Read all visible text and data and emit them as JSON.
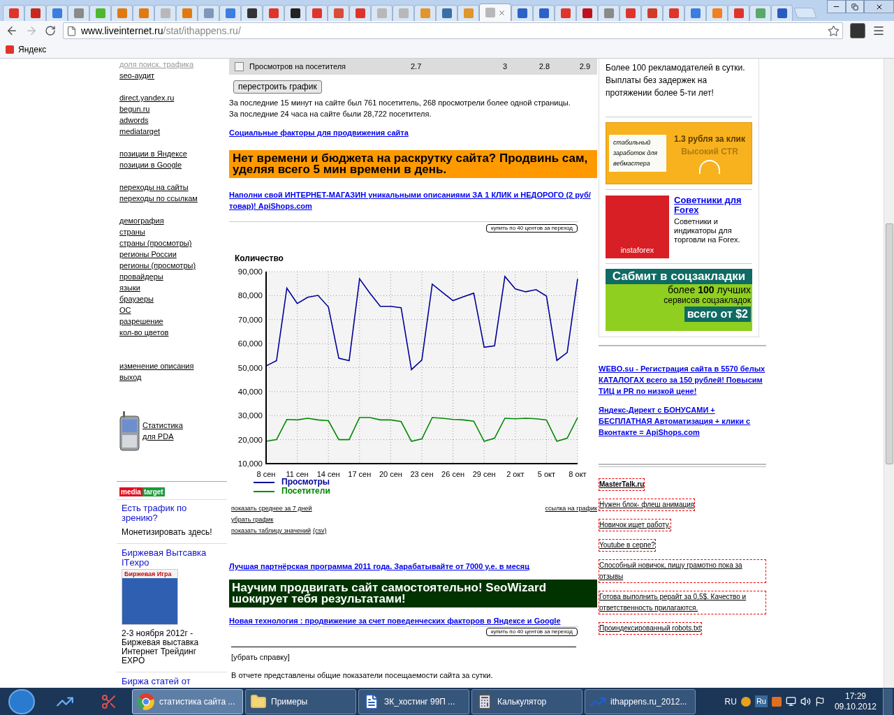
{
  "browser": {
    "tabs": [
      {
        "color": "#e0342a",
        "selected": false
      },
      {
        "color": "#c8281e",
        "selected": false
      },
      {
        "color": "#3b7de0",
        "selected": false
      },
      {
        "color": "#8a8a8a",
        "selected": false
      },
      {
        "color": "#4fb82e",
        "selected": false
      },
      {
        "color": "#e07a10",
        "selected": false
      },
      {
        "color": "#e07a10",
        "selected": false
      },
      {
        "color": "#b8b8b8",
        "selected": false
      },
      {
        "color": "#e07a10",
        "selected": false
      },
      {
        "color": "#7d98b8",
        "selected": false
      },
      {
        "color": "#3b7de0",
        "selected": false
      },
      {
        "color": "#333333",
        "selected": false
      },
      {
        "color": "#e0342a",
        "selected": false
      },
      {
        "color": "#222222",
        "selected": false
      },
      {
        "color": "#e0342a",
        "selected": false
      },
      {
        "color": "#d94c3a",
        "selected": false
      },
      {
        "color": "#e0342a",
        "selected": false
      },
      {
        "color": "#b8b8b8",
        "selected": false
      },
      {
        "color": "#b8b8b8",
        "selected": false
      },
      {
        "color": "#e0962a",
        "selected": false
      },
      {
        "color": "#3a6ea8",
        "selected": false
      },
      {
        "color": "#e0962a",
        "selected": false
      },
      {
        "color": "#b8b8b8",
        "selected": true
      },
      {
        "color": "#2c62c8",
        "selected": false
      },
      {
        "color": "#2c62c8",
        "selected": false
      },
      {
        "color": "#e0342a",
        "selected": false
      },
      {
        "color": "#c01020",
        "selected": false
      },
      {
        "color": "#8a8a8a",
        "selected": false
      },
      {
        "color": "#e0342a",
        "selected": false
      },
      {
        "color": "#d03a2a",
        "selected": false
      },
      {
        "color": "#e0342a",
        "selected": false
      },
      {
        "color": "#3b7de0",
        "selected": false
      },
      {
        "color": "#f08020",
        "selected": false
      },
      {
        "color": "#e0342a",
        "selected": false
      },
      {
        "color": "#5aa86a",
        "selected": false
      },
      {
        "color": "#2a5cc0",
        "selected": false
      }
    ],
    "url_host": "www.liveinternet.ru",
    "url_path": "/stat/ithappens.ru/",
    "bookmark": "Яндекс"
  },
  "sidebar": {
    "cut_link": "доля поиск. трафика",
    "groups": [
      [
        "seo-аудит"
      ],
      [
        "direct.yandex.ru",
        "begun.ru",
        "adwords",
        "mediatarget"
      ],
      [
        "позиции в Яндексе",
        "позиции в Google"
      ],
      [
        "переходы на сайты",
        "переходы по ссылкам"
      ],
      [
        "демография",
        "страны",
        "страны (просмотры)",
        "регионы России",
        "регионы (просмотры)",
        "провайдеры",
        "языки",
        "браузеры",
        "ОС",
        "разрешение",
        "кол-во цветов"
      ],
      [
        "изменение описания",
        "выход"
      ]
    ],
    "pda_link": "Статистика для PDA",
    "logo_left": "media",
    "logo_right": "target",
    "ad1_title": "Есть трафик по зрению?",
    "ad1_text": "Монетизировать здесь!",
    "ad2_title": "Биржевая Вытсавка ITехро",
    "ad2_image_title": "Биржевая Игра",
    "ad2_text": "2-3 ноября 2012г - Биржевая выставка Интернет Трейдинг EXPO",
    "ad3_title": "Биржа статей от"
  },
  "center": {
    "stats_row": {
      "checked": false,
      "label": "Просмотров на посетителя",
      "values": [
        "2.7",
        "3",
        "2.8",
        "2.9"
      ]
    },
    "rebuild_button": "перестроить график",
    "summary_lines": [
      "За последние 15 минут на сайте был 761 посетитель, 268 просмотрели более одной страницы.",
      "За последние 24 часа на сайте были 28,722 посетителя."
    ],
    "social_link": "Социальные факторы для продвижения сайта",
    "promo_orange": "Нет времени и бюджета на раскрутку сайта? Продвинь сам, уделяя всего 5 мин времени в день.",
    "shop_link": "Наполни свой ИНТЕРНЕТ-МАГАЗИН уникальными описаниями ЗА 1 КЛИК и НЕДОРОГО (2 руб/товар)! ApiShops.com",
    "buy_button_1": "купить по 40 центов за переход",
    "chart_data": {
      "type": "line",
      "ylabel": "Количество",
      "grid": true,
      "legend": "bottom",
      "categories": [
        "8 сен",
        null,
        null,
        "11 сен",
        null,
        null,
        "14 сен",
        null,
        null,
        "17 сен",
        null,
        null,
        "20 сен",
        null,
        null,
        "23 сен",
        null,
        null,
        "26 сен",
        null,
        null,
        "29 сен",
        null,
        null,
        "2 окт",
        null,
        null,
        "5 окт",
        null,
        null,
        "8 окт"
      ],
      "ylim": [
        10000,
        90000
      ],
      "yticks": [
        {
          "value": 10000,
          "label": "10,000"
        },
        {
          "value": 20000,
          "label": "20,000"
        },
        {
          "value": 30000,
          "label": "30,000"
        },
        {
          "value": 40000,
          "label": "40,000"
        },
        {
          "value": 50000,
          "label": "50,000"
        },
        {
          "value": 60000,
          "label": "60,000"
        },
        {
          "value": 70000,
          "label": "70,000"
        },
        {
          "value": 80000,
          "label": "80,000"
        },
        {
          "value": 90000,
          "label": "90,000"
        }
      ],
      "series": [
        {
          "name": "Просмотры",
          "color": "#000099",
          "values": [
            50700,
            52900,
            83100,
            76700,
            79300,
            80100,
            75300,
            53900,
            52900,
            87000,
            81000,
            75500,
            75500,
            75000,
            49200,
            53200,
            84800,
            81300,
            77900,
            79500,
            81000,
            58500,
            59100,
            88000,
            82800,
            81600,
            82500,
            79800,
            53000,
            56300,
            87000
          ]
        },
        {
          "name": "Посетители",
          "color": "#008800",
          "values": [
            19300,
            20000,
            28400,
            28200,
            28900,
            28200,
            27900,
            20000,
            20000,
            29200,
            29200,
            28200,
            28200,
            27500,
            19300,
            20300,
            29200,
            28900,
            28400,
            28200,
            27700,
            19300,
            20600,
            28900,
            28700,
            28900,
            28700,
            28200,
            19300,
            20600,
            29200
          ]
        }
      ]
    },
    "chart_links": {
      "average": "показать среднее за 7 дней",
      "link": "ссылка на график",
      "remove": "убрать график",
      "table": "показать таблицу значений",
      "csv": "(csv)"
    },
    "partner_link": "Лучшая партнёрская программа 2011 года. Зарабатывайте от 7000 у.е. в месяц",
    "promo_green": "Научим продвигать сайт самостоятельно! SeoWizard шокирует тебя результатами!",
    "tech_link": "Новая технология : продвижение за счет поведенческих факторов в Яндексе и Google",
    "buy_button_2": "купить по 40 центов за переход",
    "hide_help": "[убрать справку]",
    "report_text": "В отчете представлены общие показатели посещаемости сайта за сутки."
  },
  "right": {
    "intro": "Более 100 рекламодателей в сутки. Выплаты без задержек на протяжении более 5-ти лет!",
    "banner1": {
      "left": "стабильный заработок для вебмастера",
      "title": "1.3 рубля за клик",
      "subtitle": "Высокий CTR"
    },
    "forex": {
      "image_text": "instaforex",
      "title": "Советники для Forex",
      "text": "Советники и индикаторы для торговли на Forex."
    },
    "banner3": {
      "title": "Сабмит в соцзакладки",
      "line1": "более **100** лучших",
      "line2": "сервисов соцзакладок",
      "price": "всего от $2"
    },
    "links": [
      "WEBO.su - Регистрация сайта в 5570 белых КАТАЛОГАХ всего за 150 рублей! Повысим ТИЦ и PR по низкой цене!",
      "Яндекс-Директ с БОНУСАМИ + БЕСПЛАТНАЯ Автоматизация + клики с Вконтакте = ApiShops.com"
    ],
    "forum_links": [
      "MasterTalk.ru",
      "Нужен блок- флеш анимация",
      "Новичок ищет работу.",
      "Youtube в серпе?",
      "Способный новичок, пишу грамотно пока за отзывы",
      "Готова выполнить рерайт за 0,5$. Качество и ответственность прилагаются.",
      "Проиндексированный robots.txt"
    ]
  },
  "taskbar": {
    "items": [
      {
        "kind": "browser",
        "label": "статистика сайта ...",
        "selected": true
      },
      {
        "kind": "folder",
        "label": "Примеры",
        "selected": false
      },
      {
        "kind": "document",
        "label": "ЗК_хостинг 99П ...",
        "selected": false
      },
      {
        "kind": "calculator",
        "label": "Калькулятор",
        "selected": false
      },
      {
        "kind": "chart",
        "label": "ithappens.ru_2012...",
        "selected": false
      }
    ],
    "lang": "RU",
    "lang2": "Ru",
    "time": "17:29",
    "date": "09.10.2012"
  }
}
